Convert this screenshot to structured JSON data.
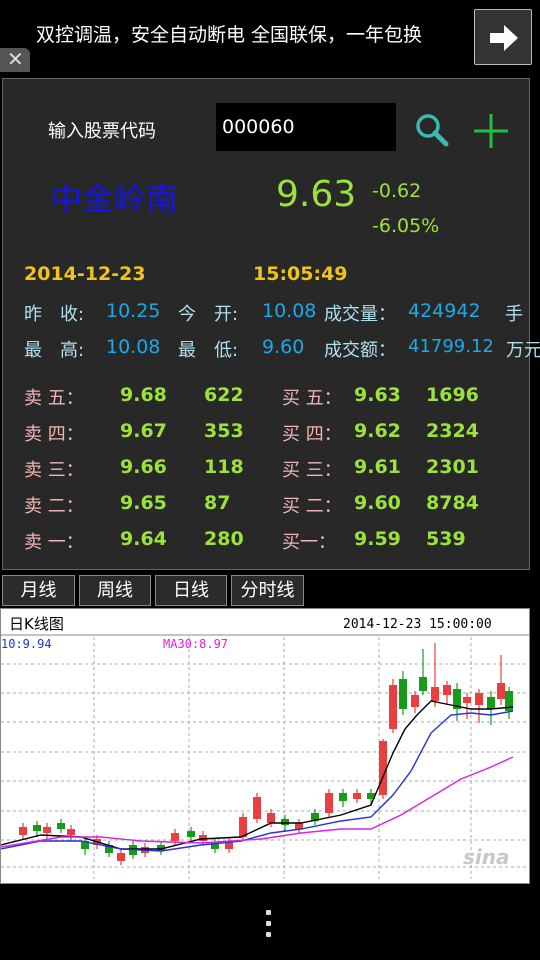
{
  "ad": {
    "text": "双控调温，安全自动断电 全国联保，一年包换",
    "button_icon": "arrow-right-icon",
    "close_glyph": "✕"
  },
  "search": {
    "label": "输入股票代码",
    "value": "000060",
    "search_icon": "search-icon",
    "add_icon": "plus-icon"
  },
  "quote": {
    "name": "中金岭南",
    "price": "9.63",
    "change": "-0.62",
    "change_pct": "-6.05%",
    "date": "2014-12-23",
    "time": "15:05:49",
    "prev_close_label": "昨　收:",
    "prev_close": "10.25",
    "open_label": "今　开:",
    "open": "10.08",
    "volume_label": "成交量：",
    "volume": "424942",
    "volume_unit": "手",
    "high_label": "最　高:",
    "high": "10.08",
    "low_label": "最　低:",
    "low": "9.60",
    "amount_label": "成交额：",
    "amount": "41799.12",
    "amount_unit": "万元"
  },
  "orderbook": {
    "asks": [
      {
        "label": "卖 五：",
        "price": "9.68",
        "vol": "622"
      },
      {
        "label": "卖 四：",
        "price": "9.67",
        "vol": "353"
      },
      {
        "label": "卖 三：",
        "price": "9.66",
        "vol": "118"
      },
      {
        "label": "卖 二：",
        "price": "9.65",
        "vol": "87"
      },
      {
        "label": "卖 一：",
        "price": "9.64",
        "vol": "280"
      }
    ],
    "bids": [
      {
        "label": "买 五：",
        "price": "9.63",
        "vol": "1696"
      },
      {
        "label": "买 四：",
        "price": "9.62",
        "vol": "2324"
      },
      {
        "label": "买 三：",
        "price": "9.61",
        "vol": "2301"
      },
      {
        "label": "买 二：",
        "price": "9.60",
        "vol": "8784"
      },
      {
        "label": "买一：",
        "price": "9.59",
        "vol": "539"
      }
    ]
  },
  "tabs": [
    "月线",
    "周线",
    "日线",
    "分时线"
  ],
  "chart": {
    "title": "日K线图",
    "timestamp": "2014-12-23 15:00:00",
    "ma_left": "10:9.94",
    "ma30": "MA30:8.97",
    "watermark": "sina",
    "colors": {
      "up": "#e84040",
      "down": "#1a9a1a",
      "ma_short": "#000000",
      "ma_mid": "#2233dd",
      "ma30": "#e020e0"
    }
  },
  "nav": {
    "menu_icon": "overflow-menu-icon"
  }
}
